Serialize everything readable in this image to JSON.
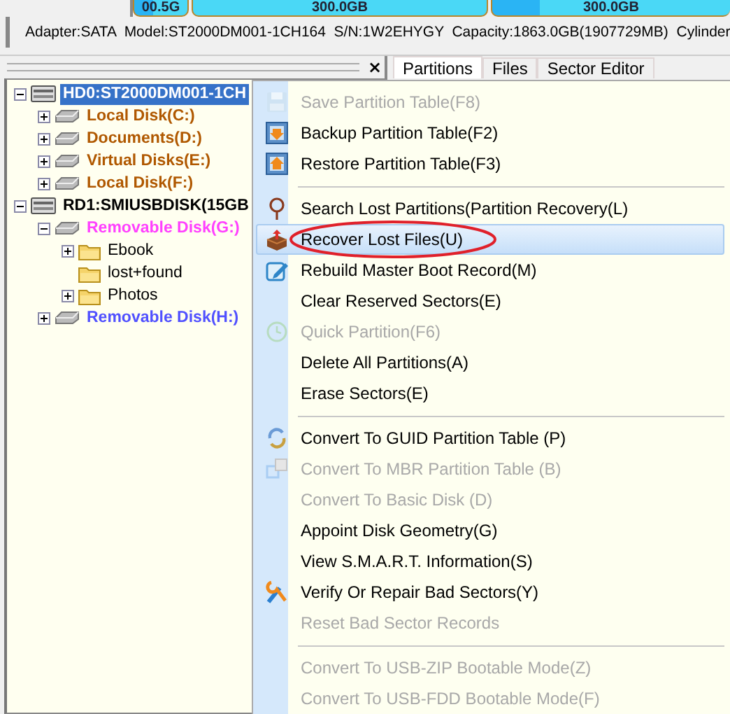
{
  "disk_map": {
    "segments": [
      {
        "label": "00.5G",
        "selected": false
      },
      {
        "label": "300.0GB",
        "selected": false
      },
      {
        "label": "300.0GB",
        "selected": false
      }
    ]
  },
  "disk_info": "Adapter:SATA  Model:ST2000DM001-1CH164  S/N:1W2EHYGY  Capacity:1863.0GB(1907729MB)  Cylinder",
  "close_label": "×",
  "tree": [
    {
      "label": "HD0:ST2000DM001-1CH",
      "kind": "disk",
      "expandable": true,
      "expanded": true,
      "selected": true,
      "children": [
        {
          "label": "Local Disk(C:)",
          "kind": "partition",
          "expandable": true,
          "expanded": false,
          "selected": false,
          "color": "#b05800"
        },
        {
          "label": "Documents(D:)",
          "kind": "partition",
          "expandable": true,
          "expanded": false,
          "selected": false,
          "color": "#b05800"
        },
        {
          "label": "Virtual Disks(E:)",
          "kind": "partition",
          "expandable": true,
          "expanded": false,
          "selected": false,
          "color": "#b05800"
        },
        {
          "label": "Local Disk(F:)",
          "kind": "partition",
          "expandable": true,
          "expanded": false,
          "selected": false,
          "color": "#b05800"
        }
      ]
    },
    {
      "label": "RD1:SMIUSBDISK(15GB",
      "kind": "disk",
      "expandable": true,
      "expanded": true,
      "selected": false,
      "children": [
        {
          "label": "Removable Disk(G:)",
          "kind": "partition",
          "expandable": true,
          "expanded": true,
          "selected": false,
          "color": "#ff40ff",
          "children": [
            {
              "label": "Ebook",
              "kind": "folder",
              "expandable": true,
              "expanded": false,
              "selected": false
            },
            {
              "label": "lost+found",
              "kind": "folder",
              "expandable": false,
              "selected": false
            },
            {
              "label": "Photos",
              "kind": "folder",
              "expandable": true,
              "expanded": false,
              "selected": false
            }
          ]
        },
        {
          "label": "Removable Disk(H:)",
          "kind": "partition",
          "expandable": true,
          "expanded": false,
          "selected": false,
          "color": "#5050ff"
        }
      ]
    }
  ],
  "tabs": [
    {
      "label": "Partitions",
      "selected": true
    },
    {
      "label": "Files",
      "selected": false
    },
    {
      "label": "Sector Editor",
      "selected": false
    }
  ],
  "context_menu": [
    {
      "kind": "save",
      "label": "Save Partition Table(F8)",
      "disabled": true,
      "selected": false,
      "circled": false
    },
    {
      "kind": "backup",
      "label": "Backup Partition Table(F2)",
      "disabled": false,
      "selected": false,
      "circled": false
    },
    {
      "kind": "restore",
      "label": "Restore Partition Table(F3)",
      "disabled": false,
      "selected": false,
      "circled": false
    },
    {
      "kind": "separator"
    },
    {
      "kind": "search",
      "label": "Search Lost Partitions(Partition Recovery(L)",
      "disabled": false,
      "selected": false,
      "circled": false
    },
    {
      "kind": "recover",
      "label": "Recover Lost Files(U)",
      "disabled": false,
      "selected": true,
      "circled": true
    },
    {
      "kind": "edit",
      "label": "Rebuild Master Boot Record(M)",
      "disabled": false,
      "selected": false,
      "circled": false
    },
    {
      "kind": "plain",
      "label": "Clear Reserved Sectors(E)",
      "disabled": false,
      "selected": false,
      "circled": false
    },
    {
      "kind": "clock",
      "label": "Quick Partition(F6)",
      "disabled": true,
      "selected": false,
      "circled": false
    },
    {
      "kind": "plain",
      "label": "Delete All Partitions(A)",
      "disabled": false,
      "selected": false,
      "circled": false
    },
    {
      "kind": "plain",
      "label": "Erase Sectors(E)",
      "disabled": false,
      "selected": false,
      "circled": false
    },
    {
      "kind": "separator"
    },
    {
      "kind": "convert",
      "label": "Convert To GUID Partition Table (P)",
      "disabled": false,
      "selected": false,
      "circled": false
    },
    {
      "kind": "squares",
      "label": "Convert To MBR Partition Table (B)",
      "disabled": true,
      "selected": false,
      "circled": false
    },
    {
      "kind": "plain",
      "label": "Convert To Basic Disk (D)",
      "disabled": true,
      "selected": false,
      "circled": false
    },
    {
      "kind": "plain",
      "label": "Appoint Disk Geometry(G)",
      "disabled": false,
      "selected": false,
      "circled": false
    },
    {
      "kind": "plain",
      "label": "View S.M.A.R.T. Information(S)",
      "disabled": false,
      "selected": false,
      "circled": false
    },
    {
      "kind": "tools",
      "label": "Verify Or Repair Bad Sectors(Y)",
      "disabled": false,
      "selected": false,
      "circled": false
    },
    {
      "kind": "plain",
      "label": "Reset Bad Sector Records",
      "disabled": true,
      "selected": false,
      "circled": false
    },
    {
      "kind": "separator"
    },
    {
      "kind": "plain",
      "label": "Convert To USB-ZIP Bootable Mode(Z)",
      "disabled": true,
      "selected": false,
      "circled": false
    },
    {
      "kind": "plain",
      "label": "Convert To USB-FDD Bootable Mode(F)",
      "disabled": true,
      "selected": false,
      "circled": false
    }
  ]
}
